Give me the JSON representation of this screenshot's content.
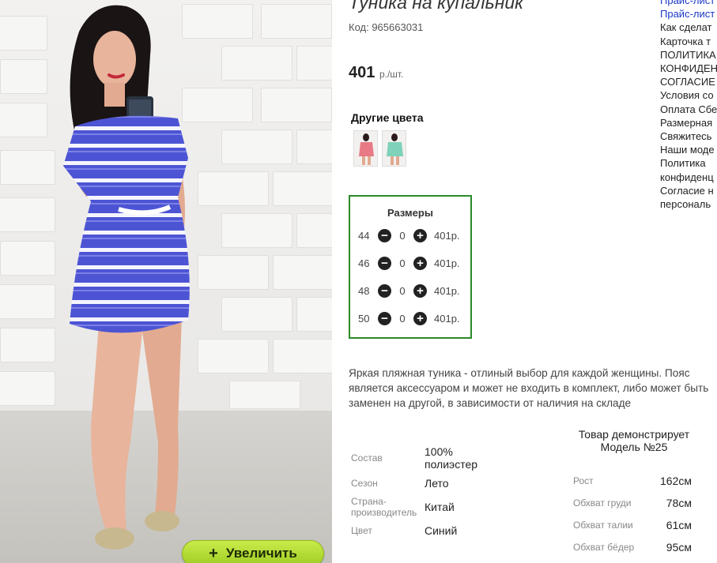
{
  "product": {
    "title": "Туника на купальник",
    "code": "Код: 965663031",
    "price": "401",
    "price_unit": "р./шт.",
    "zoom_label": "Увеличить"
  },
  "colors": {
    "title": "Другие цвета",
    "thumbs": [
      {
        "name": "pink",
        "color": "#e87a86"
      },
      {
        "name": "mint",
        "color": "#7fd1b9"
      }
    ]
  },
  "sizes": {
    "title": "Размеры",
    "rows": [
      {
        "size": "44",
        "qty": "0",
        "price": "401р."
      },
      {
        "size": "46",
        "qty": "0",
        "price": "401р."
      },
      {
        "size": "48",
        "qty": "0",
        "price": "401р."
      },
      {
        "size": "50",
        "qty": "0",
        "price": "401р."
      }
    ]
  },
  "description": "Яркая пляжная туника - отлиный выбор для каждой женщины. Пояс является аксессуаром и может не входить в комплект, либо может быть заменен на другой, в зависимости от наличия на складе",
  "attributes": [
    {
      "label": "Состав",
      "value": "100% полиэстер"
    },
    {
      "label": "Сезон",
      "value": "Лето"
    },
    {
      "label": "Страна-производитель",
      "value": "Китай"
    },
    {
      "label": "Цвет",
      "value": "Синий"
    }
  ],
  "model": {
    "title": "Товар демонстрирует Модель №25",
    "measurements": [
      {
        "label": "Рост",
        "value": "162см"
      },
      {
        "label": "Обхват груди",
        "value": "78см"
      },
      {
        "label": "Обхват талии",
        "value": "61см"
      },
      {
        "label": "Обхват бёдер",
        "value": "95см"
      }
    ]
  },
  "sidebar": {
    "links": [
      "Прайс-лист",
      "Прайс-лист"
    ],
    "items": [
      "Как сделат",
      "Карточка т",
      "ПОЛИТИКА",
      "КОНФИДЕН",
      "СОГЛАСИЕ",
      "Условия со",
      "Оплата Сбе",
      "Размерная",
      "Свяжитесь",
      "Наши моде",
      "Политика",
      "конфиденц",
      "Согласие н",
      "персональ"
    ]
  },
  "colors_theme": {
    "accent_green": "#2a8a2a",
    "link_blue": "#1a38c8",
    "button_green": "#b3dd35",
    "dress_blue": "#4d54d4"
  },
  "icons": {
    "plus": "plus-icon",
    "minus": "minus-icon"
  }
}
